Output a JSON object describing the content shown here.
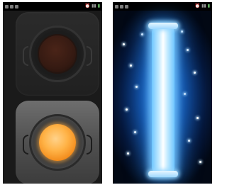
{
  "screens": [
    {
      "name": "flashlight-button-screen",
      "statusbar": {
        "icons": [
          "notification-icon",
          "sd-card-icon",
          "alarm-icon",
          "signal-icon",
          "battery-icon"
        ]
      },
      "buttons": [
        {
          "name": "light-off-button",
          "state": "off",
          "lens_color": "#351a12"
        },
        {
          "name": "light-on-button",
          "state": "on",
          "lens_color": "#ffb347"
        }
      ]
    },
    {
      "name": "glow-tube-screen",
      "statusbar": {
        "icons": [
          "notification-icon",
          "sd-card-icon",
          "alarm-icon",
          "signal-icon",
          "battery-icon"
        ]
      },
      "tube": {
        "color": "#bfe9ff",
        "glow_color": "#1f6fd0"
      }
    }
  ]
}
